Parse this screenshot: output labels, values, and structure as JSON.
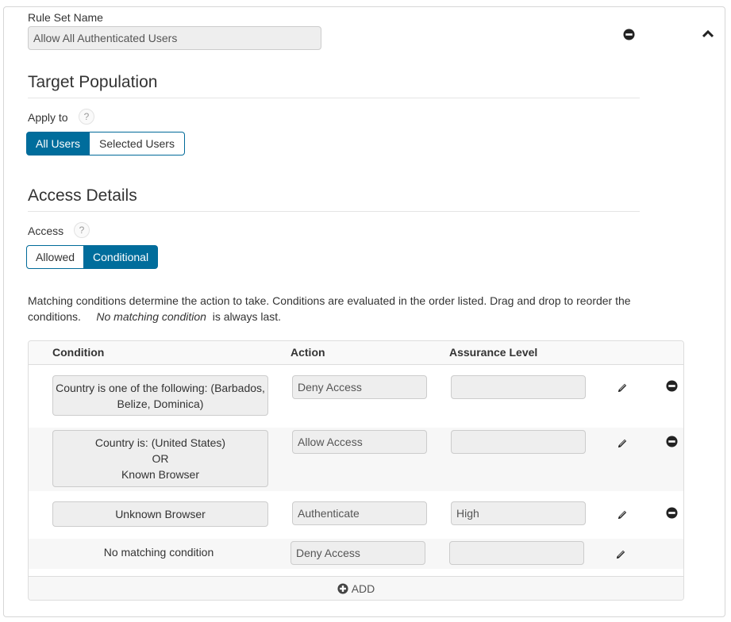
{
  "rule_set": {
    "name_label": "Rule Set Name",
    "name_value": "Allow All Authenticated Users",
    "remove_icon": "minus-circle-icon",
    "collapse_icon": "chevron-up-icon"
  },
  "target_population": {
    "title": "Target Population",
    "apply_to_label": "Apply to",
    "help_glyph": "?",
    "options": [
      {
        "label": "All Users",
        "active": true
      },
      {
        "label": "Selected Users",
        "active": false
      }
    ]
  },
  "access_details": {
    "title": "Access Details",
    "access_label": "Access",
    "help_glyph": "?",
    "options": [
      {
        "label": "Allowed",
        "active": false
      },
      {
        "label": "Conditional",
        "active": true
      }
    ]
  },
  "description": {
    "text_before": "Matching conditions determine the action to take. Conditions are evaluated in the order listed. Drag and drop to reorder the conditions.",
    "emphasis": "No matching condition",
    "text_after": "is always last."
  },
  "conditions_table": {
    "headers": {
      "condition": "Condition",
      "action": "Action",
      "assurance": "Assurance Level"
    },
    "rows": [
      {
        "condition_lines": [
          "Country is one of the following: (Barbados,",
          "Belize, Dominica)"
        ],
        "action": "Deny Access",
        "assurance": "",
        "editable": true,
        "removable": true
      },
      {
        "condition_lines": [
          "Country is: (United States)",
          "OR",
          "Known Browser"
        ],
        "action": "Allow Access",
        "assurance": "",
        "editable": true,
        "removable": true
      },
      {
        "condition_lines": [
          "Unknown Browser"
        ],
        "action": "Authenticate",
        "assurance": "High",
        "editable": true,
        "removable": true
      },
      {
        "condition_lines": [
          "No matching condition"
        ],
        "action": "Deny Access",
        "assurance": "",
        "editable": true,
        "removable": false
      }
    ],
    "add_label": "ADD",
    "edit_icon": "pencil-icon",
    "remove_icon": "minus-circle-icon",
    "add_icon": "plus-circle-icon"
  },
  "colors": {
    "primary": "#006d9c",
    "readonly_bg": "#eeeeee",
    "alt_row_bg": "#f7f7f7"
  }
}
